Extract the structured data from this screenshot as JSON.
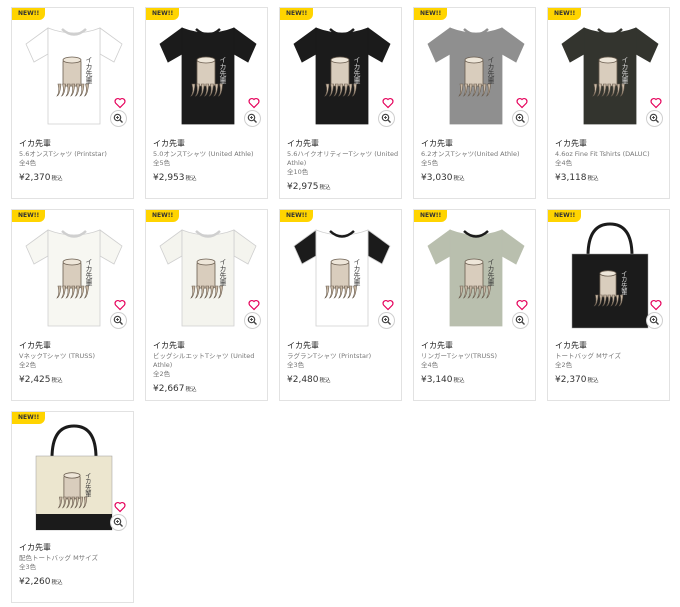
{
  "badge_text": "NEW!!",
  "items": [
    {
      "name": "イカ先輩",
      "product": "5.6オンスTシャツ (Printstar)",
      "colors": "全4色",
      "price": "¥2,370",
      "tax": "税込",
      "garment": "tee",
      "color": "#ffffff",
      "sleeve": "#ffffff",
      "trim": "#ffffff"
    },
    {
      "name": "イカ先輩",
      "product": "5.0オンスTシャツ (United Athle)",
      "colors": "全5色",
      "price": "¥2,953",
      "tax": "税込",
      "garment": "tee",
      "color": "#1b1b1b",
      "sleeve": "#1b1b1b",
      "trim": "#1b1b1b"
    },
    {
      "name": "イカ先輩",
      "product": "5.6ハイクオリティーTシャツ (United Athle)",
      "colors": "全10色",
      "price": "¥2,975",
      "tax": "税込",
      "garment": "tee",
      "color": "#1b1b1b",
      "sleeve": "#1b1b1b",
      "trim": "#1b1b1b"
    },
    {
      "name": "イカ先輩",
      "product": "6.2オンスTシャツ(United Athle)",
      "colors": "全5色",
      "price": "¥3,030",
      "tax": "税込",
      "garment": "tee",
      "color": "#8f8f8f",
      "sleeve": "#8f8f8f",
      "trim": "#8f8f8f"
    },
    {
      "name": "イカ先輩",
      "product": "4.6oz Fine Fit Tshirts (DALUC)",
      "colors": "全4色",
      "price": "¥3,118",
      "tax": "税込",
      "garment": "tee",
      "color": "#33342e",
      "sleeve": "#33342e",
      "trim": "#33342e"
    },
    {
      "name": "イカ先輩",
      "product": "VネックTシャツ (TRUSS)",
      "colors": "全2色",
      "price": "¥2,425",
      "tax": "税込",
      "garment": "tee",
      "color": "#f7f7f2",
      "sleeve": "#f7f7f2",
      "trim": "#f7f7f2"
    },
    {
      "name": "イカ先輩",
      "product": "ビッグシルエットTシャツ (United Athle)",
      "colors": "全2色",
      "price": "¥2,667",
      "tax": "税込",
      "garment": "tee",
      "color": "#f4f4ee",
      "sleeve": "#f4f4ee",
      "trim": "#f4f4ee"
    },
    {
      "name": "イカ先輩",
      "product": "ラグランTシャツ (Printstar)",
      "colors": "全3色",
      "price": "¥2,480",
      "tax": "税込",
      "garment": "tee",
      "color": "#ffffff",
      "sleeve": "#1b1b1b",
      "trim": "#1b1b1b"
    },
    {
      "name": "イカ先輩",
      "product": "リンガーTシャツ(TRUSS)",
      "colors": "全4色",
      "price": "¥3,140",
      "tax": "税込",
      "garment": "tee",
      "color": "#b9bfae",
      "sleeve": "#b9bfae",
      "trim": "#1b1b1b"
    },
    {
      "name": "イカ先輩",
      "product": "トートバッグ Mサイズ",
      "colors": "全2色",
      "price": "¥2,370",
      "tax": "税込",
      "garment": "tote",
      "color": "#1b1b1b",
      "sleeve": "#1b1b1b",
      "trim": "#1b1b1b"
    },
    {
      "name": "イカ先輩",
      "product": "配色トートバッグ Mサイズ",
      "colors": "全3色",
      "price": "¥2,260",
      "tax": "税込",
      "garment": "tote",
      "color": "#ece6cf",
      "sleeve": "#ece6cf",
      "trim": "#1b1b1b"
    }
  ],
  "design_text": "イカ先輩",
  "accent_color": "#e5005a",
  "icons": {
    "favorite": "heart-icon",
    "zoom": "magnifier-icon"
  }
}
